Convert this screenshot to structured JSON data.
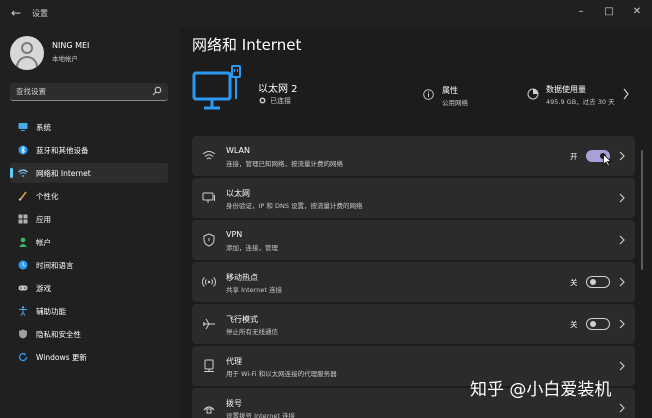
{
  "window": {
    "title": "设置"
  },
  "user": {
    "name": "NING MEI",
    "account_type": "本地帐户"
  },
  "search": {
    "placeholder": "查找设置"
  },
  "sidebar": {
    "items": [
      {
        "label": "系统",
        "icon": "system-icon"
      },
      {
        "label": "蓝牙和其他设备",
        "icon": "bluetooth-icon"
      },
      {
        "label": "网络和 Internet",
        "icon": "network-icon",
        "selected": true
      },
      {
        "label": "个性化",
        "icon": "personalization-icon"
      },
      {
        "label": "应用",
        "icon": "apps-icon"
      },
      {
        "label": "帐户",
        "icon": "account-icon"
      },
      {
        "label": "时间和语言",
        "icon": "time-language-icon"
      },
      {
        "label": "游戏",
        "icon": "gaming-icon"
      },
      {
        "label": "辅助功能",
        "icon": "accessibility-icon"
      },
      {
        "label": "隐私和安全性",
        "icon": "privacy-icon"
      },
      {
        "label": "Windows 更新",
        "icon": "windows-update-icon"
      }
    ]
  },
  "main": {
    "title": "网络和 Internet",
    "ethernet": {
      "name": "以太网 2",
      "status": "已连接"
    },
    "properties": {
      "title": "属性",
      "subtitle": "公用网络"
    },
    "data_usage": {
      "title": "数据使用量",
      "subtitle": "495.9 GB，过去 30 天"
    },
    "cards": [
      {
        "title": "WLAN",
        "subtitle": "连接，管理已知网络，按流量计费的网络",
        "icon": "wifi-icon",
        "toggle": "开",
        "toggle_on": true
      },
      {
        "title": "以太网",
        "subtitle": "身份验证，IP 和 DNS 设置，按流量计费的网络",
        "icon": "ethernet-icon"
      },
      {
        "title": "VPN",
        "subtitle": "添加，连接，管理",
        "icon": "vpn-shield-icon"
      },
      {
        "title": "移动热点",
        "subtitle": "共享 Internet 连接",
        "icon": "hotspot-icon",
        "toggle": "关",
        "toggle_on": false
      },
      {
        "title": "飞行模式",
        "subtitle": "停止所有无线通信",
        "icon": "airplane-icon",
        "toggle": "关",
        "toggle_on": false
      },
      {
        "title": "代理",
        "subtitle": "用于 Wi-Fi 和以太网连接的代理服务器",
        "icon": "proxy-icon"
      },
      {
        "title": "拨号",
        "subtitle": "设置拨号 Internet 连接",
        "icon": "dialup-icon"
      }
    ]
  },
  "watermark": {
    "text": "知乎 @小白爱装机"
  },
  "colors": {
    "accent": "#60cdff",
    "toggle_on": "#a7a1d8",
    "card_bg": "#2b2b2b",
    "monitor_blue": "#2b9af3"
  }
}
